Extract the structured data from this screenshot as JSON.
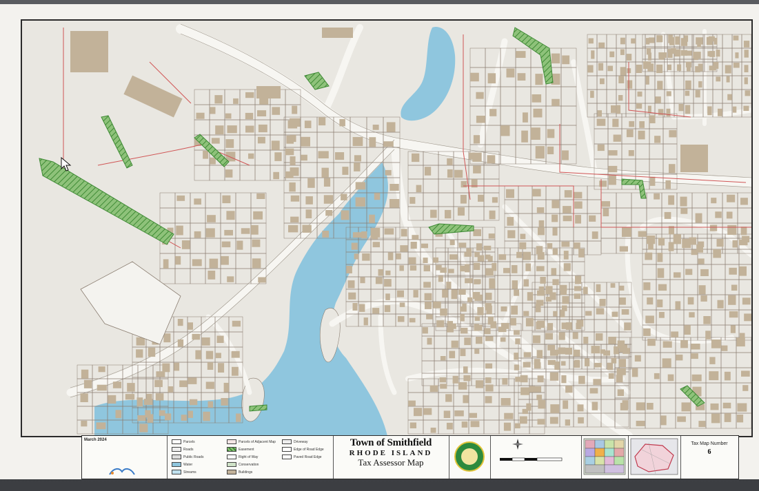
{
  "map": {
    "colors": {
      "background": "#e9e7e1",
      "parcel_line": "#8a7d70",
      "parcel_red": "#d05555",
      "building": "#c2b299",
      "water": "#8fc6de",
      "road": "#f7f6f2",
      "easement_green": "#4c9a3c"
    }
  },
  "title_block": {
    "notes_date": "March 2024",
    "title_line1": "Town of Smithfield",
    "title_line2": "RHODE ISLAND",
    "title_line3": "Tax Assessor Map",
    "map_number_label": "Tax Map Number",
    "map_number": "6"
  },
  "legend": {
    "items": [
      "Parcels",
      "Roads",
      "Public Roads",
      "Water",
      "Streams",
      "Parcels of Adjacent Map",
      "Easement",
      "Right of Way",
      "Conservation",
      "Buildings",
      "Driveway",
      "Edge of Road Edge",
      "Paved Road Edge"
    ]
  },
  "icons": {
    "cursor": "mouse-pointer-icon",
    "north_arrow": "compass-icon",
    "seal": "town-seal-icon"
  }
}
